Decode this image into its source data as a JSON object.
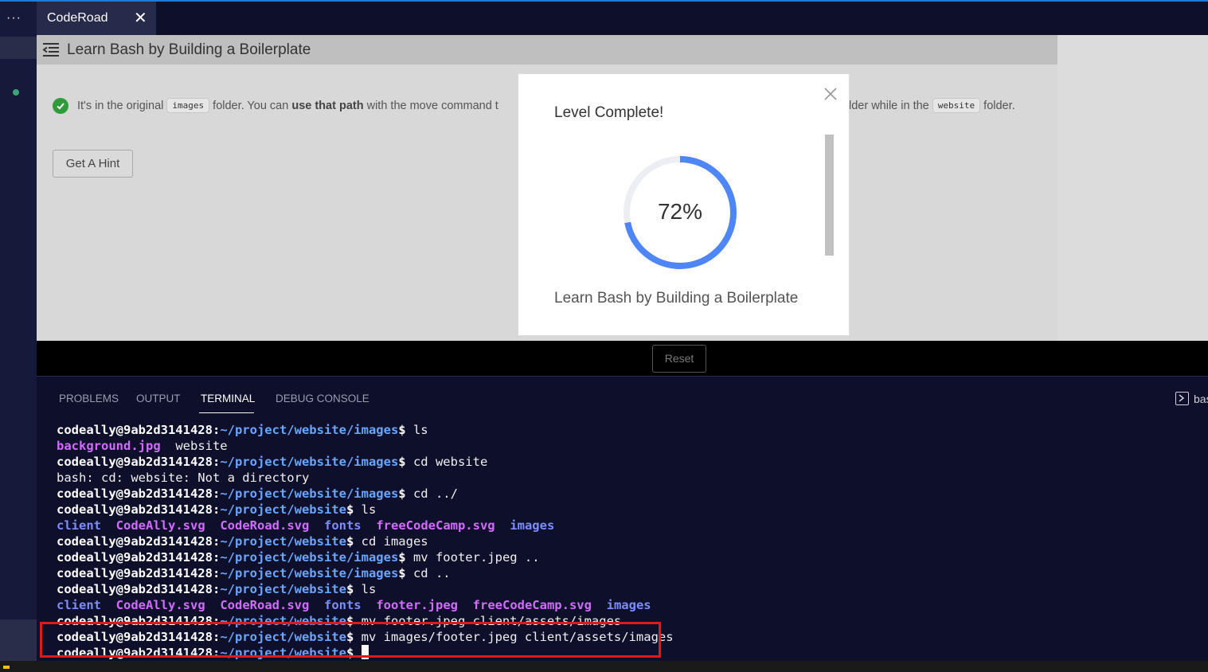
{
  "app": {
    "tab_label": "CodeRoad",
    "tab_close": "✕",
    "activity_dots": "···"
  },
  "header": {
    "title": "Learn Bash by Building a Boilerplate"
  },
  "step": {
    "text1": "It's in the original ",
    "code1": "images",
    "text2": " folder. You can ",
    "bold": "use that path",
    "text3": " with the move command t",
    "text4": "lder while in the ",
    "code2": "website",
    "text5": " folder."
  },
  "buttons": {
    "hint": "Get A Hint",
    "reset": "Reset"
  },
  "modal": {
    "title": "Level Complete!",
    "progress_value": 0.72,
    "progress_text": "72%",
    "subtitle": "Learn Bash by Building a Boilerplate"
  },
  "panel_tabs": [
    "PROBLEMS",
    "OUTPUT",
    "TERMINAL",
    "DEBUG CONSOLE"
  ],
  "terminal_profile": "bas",
  "terminal": {
    "user": "codeally@9ab2d3141428",
    "lines": [
      {
        "path": "~/project/website/images",
        "cmd": " ls"
      },
      {
        "out": [
          {
            "t": "background.jpg",
            "c": "m"
          },
          {
            "t": "  website",
            "c": ""
          }
        ]
      },
      {
        "path": "~/project/website/images",
        "cmd": " cd website"
      },
      {
        "out": [
          {
            "t": "bash: cd: website: Not a directory",
            "c": ""
          }
        ]
      },
      {
        "path": "~/project/website/images",
        "cmd": " cd ../"
      },
      {
        "path": "~/project/website",
        "cmd": " ls"
      },
      {
        "out": [
          {
            "t": "client",
            "c": "d"
          },
          {
            "t": "  ",
            "c": ""
          },
          {
            "t": "CodeAlly.svg",
            "c": "m"
          },
          {
            "t": "  ",
            "c": ""
          },
          {
            "t": "CodeRoad.svg",
            "c": "m"
          },
          {
            "t": "  ",
            "c": ""
          },
          {
            "t": "fonts",
            "c": "d"
          },
          {
            "t": "  ",
            "c": ""
          },
          {
            "t": "freeCodeCamp.svg",
            "c": "m"
          },
          {
            "t": "  ",
            "c": ""
          },
          {
            "t": "images",
            "c": "d"
          }
        ]
      },
      {
        "path": "~/project/website",
        "cmd": " cd images"
      },
      {
        "path": "~/project/website/images",
        "cmd": " mv footer.jpeg .."
      },
      {
        "path": "~/project/website/images",
        "cmd": " cd .."
      },
      {
        "path": "~/project/website",
        "cmd": " ls"
      },
      {
        "out": [
          {
            "t": "client",
            "c": "d"
          },
          {
            "t": "  ",
            "c": ""
          },
          {
            "t": "CodeAlly.svg",
            "c": "m"
          },
          {
            "t": "  ",
            "c": ""
          },
          {
            "t": "CodeRoad.svg",
            "c": "m"
          },
          {
            "t": "  ",
            "c": ""
          },
          {
            "t": "fonts",
            "c": "d"
          },
          {
            "t": "  ",
            "c": ""
          },
          {
            "t": "footer.jpeg",
            "c": "m"
          },
          {
            "t": "  ",
            "c": ""
          },
          {
            "t": "freeCodeCamp.svg",
            "c": "m"
          },
          {
            "t": "  ",
            "c": ""
          },
          {
            "t": "images",
            "c": "d"
          }
        ]
      },
      {
        "path": "~/project/website",
        "cmd": " mv footer.jpeg client/assets/images"
      },
      {
        "path": "~/project/website",
        "cmd": " mv images/footer.jpeg client/assets/images"
      },
      {
        "path": "~/project/website",
        "cmd": " ",
        "cursor": true
      }
    ]
  },
  "colors": {
    "accent": "#1f7ad8",
    "progress": "#4f86f7",
    "check": "#2f9b3a",
    "highlight": "#e11919"
  }
}
